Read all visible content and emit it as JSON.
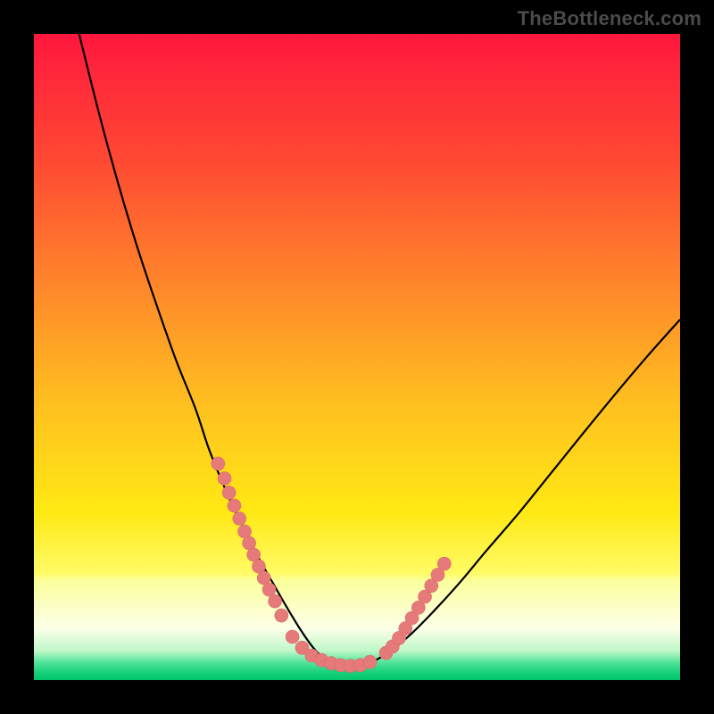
{
  "watermark": {
    "text": "TheBottleneck.com"
  },
  "colors": {
    "frame": "#000000",
    "curve": "#000000",
    "marker_fill": "#e67a7a",
    "marker_stroke": "#d86a6a",
    "gradient_stops": [
      {
        "offset": 0.0,
        "color": "#ff173e"
      },
      {
        "offset": 0.2,
        "color": "#ff4a33"
      },
      {
        "offset": 0.4,
        "color": "#ff8a2a"
      },
      {
        "offset": 0.58,
        "color": "#ffc21f"
      },
      {
        "offset": 0.74,
        "color": "#ffe914"
      },
      {
        "offset": 0.835,
        "color": "#fffb66"
      },
      {
        "offset": 0.845,
        "color": "#fbff9a"
      },
      {
        "offset": 0.92,
        "color": "#fdffe8"
      },
      {
        "offset": 0.955,
        "color": "#bdf7c8"
      },
      {
        "offset": 0.972,
        "color": "#55e49a"
      },
      {
        "offset": 0.988,
        "color": "#17d17a"
      },
      {
        "offset": 1.0,
        "color": "#00c46b"
      }
    ]
  },
  "chart_data": {
    "type": "line",
    "title": "",
    "xlabel": "",
    "ylabel": "",
    "xlim": [
      0,
      100
    ],
    "ylim": [
      0,
      100
    ],
    "grid": false,
    "legend": false,
    "series": [
      {
        "name": "bottleneck-curve",
        "x": [
          7,
          10,
          13,
          16,
          19,
          22,
          25,
          27,
          29,
          31,
          33,
          35,
          37,
          39,
          41,
          43,
          45,
          47,
          50,
          54,
          58,
          62,
          66,
          70,
          75,
          80,
          85,
          90,
          95,
          100
        ],
        "y": [
          100,
          88,
          77,
          67,
          58,
          49.5,
          42,
          36,
          31,
          26.5,
          22.5,
          18.5,
          15,
          11.5,
          8.2,
          5.3,
          3.2,
          2.0,
          2.0,
          3.7,
          6.8,
          10.8,
          15.2,
          20,
          25.8,
          32,
          38.2,
          44.3,
          50.2,
          55.8
        ]
      }
    ],
    "markers": [
      {
        "name": "left-cluster",
        "x": [
          28.5,
          29.5,
          30.2,
          31.0,
          31.8,
          32.6,
          33.3,
          34.0,
          34.8,
          35.6,
          36.4,
          37.3,
          38.3
        ],
        "y": [
          33.5,
          31.2,
          29.0,
          27.0,
          25.0,
          23.0,
          21.2,
          19.4,
          17.6,
          15.8,
          14.0,
          12.2,
          10.0
        ]
      },
      {
        "name": "bottom-cluster",
        "x": [
          40.0,
          41.5,
          43.0,
          44.5,
          46.0,
          47.5,
          49.0,
          50.5,
          52.0
        ],
        "y": [
          6.7,
          5.0,
          3.8,
          3.1,
          2.6,
          2.3,
          2.2,
          2.3,
          2.8
        ]
      },
      {
        "name": "right-cluster",
        "x": [
          54.5,
          55.5,
          56.5,
          57.5,
          58.5,
          59.5,
          60.5,
          61.5,
          62.5,
          63.5
        ],
        "y": [
          4.2,
          5.2,
          6.5,
          8.0,
          9.6,
          11.2,
          12.9,
          14.6,
          16.3,
          18.0
        ]
      }
    ]
  }
}
